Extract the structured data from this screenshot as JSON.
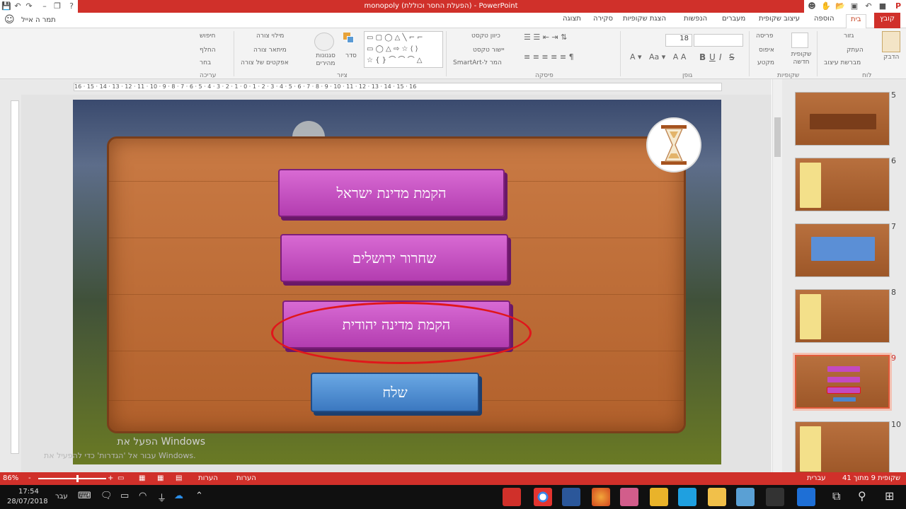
{
  "window": {
    "title": "monopoly (הפעלת החסר וכוללת) - PowerPoint",
    "help": "?",
    "account_name": "תמר ה אייל"
  },
  "tabs": [
    "קובץ",
    "בית",
    "הוספה",
    "עיצוב שקופית",
    "מעברים",
    "הנפשות",
    "הצגת שקופיות",
    "סקירה",
    "תצוגה"
  ],
  "ribbon": {
    "clipboard": {
      "paste": "הדבק",
      "cut": "גזור",
      "copy": "העתק",
      "format_painter": "מברשת עיצוב",
      "group": "לוח"
    },
    "slides": {
      "new_slide": "שקופית חדשה",
      "layout": "פריסה",
      "reset": "איפוס",
      "section": "מקטע",
      "group": "שקופיות"
    },
    "font": {
      "size": "18",
      "bold": "B",
      "italic": "I",
      "underline": "U",
      "strike": "S",
      "group": "גופן"
    },
    "paragraph": {
      "text_direction": "כיוון טקסט",
      "align_text": "יישור טקסט",
      "smartart": "SmartArt-המר ל",
      "group": "פיסקה"
    },
    "drawing": {
      "arrange": "סדר",
      "quick_styles": "סגנונות מהירים",
      "shape_fill": "מילוי צורה",
      "shape_outline": "מיתאר צורה",
      "shape_effects": "אפקטים של צורה",
      "group": "ציור"
    },
    "editing": {
      "find": "חיפוש",
      "replace": "החלף",
      "select": "בחר",
      "group": "עריכה"
    }
  },
  "ruler": {
    "h_ticks": "16 · 15 · 14 · 13 · 12 · 11 · 10 · 9 · 8 · 7 · 6 · 5 · 4 · 3 · 2 · 1 · 0 · 1 · 2 · 3 · 4 · 5 · 6 · 7 · 8 · 9 · 10 · 11 · 12 · 13 · 14 · 15 · 16"
  },
  "slide": {
    "btn1": "הקמת מדינת ישראל",
    "btn2": "שחרור ירושלים",
    "btn3": "הקמת מדינה יהודית",
    "send": "שלח",
    "watermark_title": "הפעל את Windows",
    "watermark_sub": "עבור אל 'הגדרות' כדי להפעיל את Windows."
  },
  "thumbnails": [
    {
      "num": "5",
      "selected": false
    },
    {
      "num": "6",
      "selected": false
    },
    {
      "num": "7",
      "selected": false
    },
    {
      "num": "8",
      "selected": false
    },
    {
      "num": "9",
      "selected": true
    },
    {
      "num": "10",
      "selected": false
    }
  ],
  "statusbar": {
    "slide_info": "שקופית 9 מתוך 41",
    "language": "עברית",
    "notes": "הערות",
    "comments": "הערות",
    "zoom": "86%",
    "zoom_minus": "-",
    "zoom_plus": "+"
  },
  "taskbar": {
    "time": "17:54",
    "date": "28/07/2018",
    "lang": "עבר"
  },
  "colors": {
    "accent": "#d0302a",
    "selection": "#e0161b"
  }
}
